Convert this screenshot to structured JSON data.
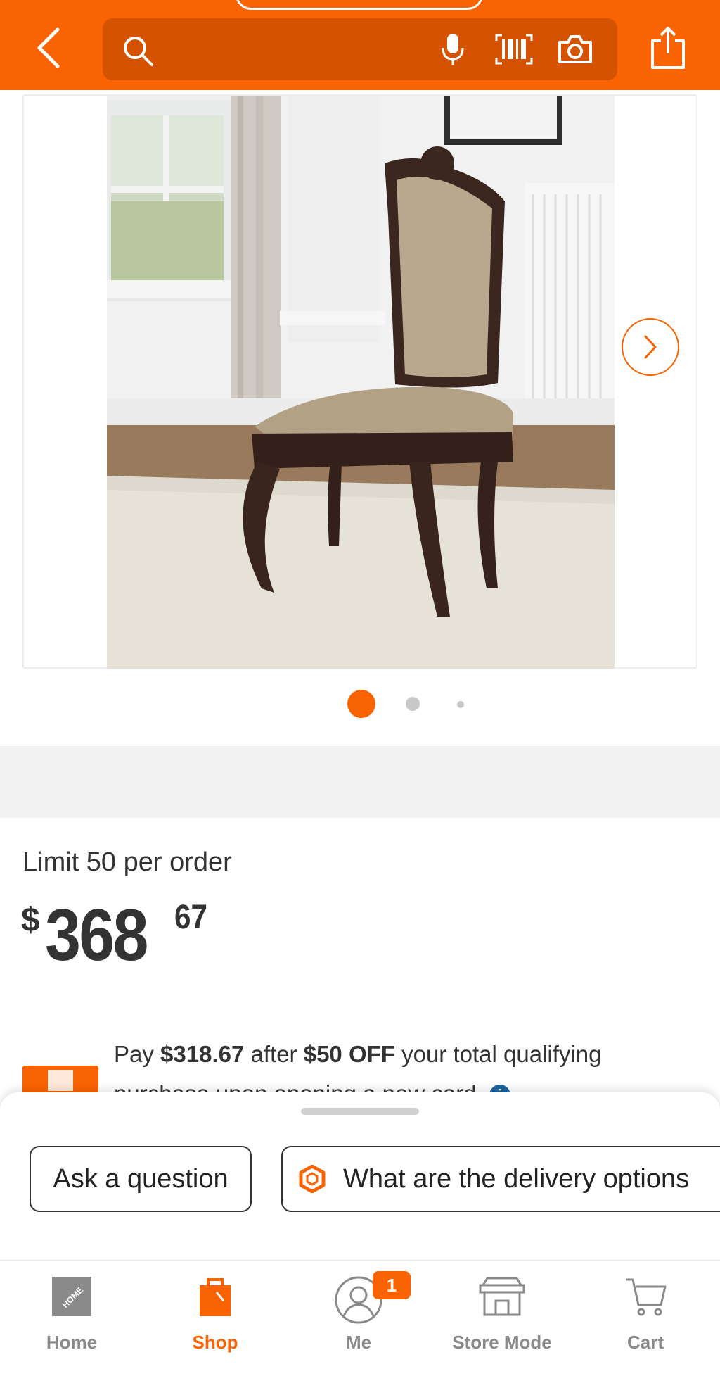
{
  "colors": {
    "brand_orange": "#f96302",
    "search_bg": "#d45200",
    "text": "#333333",
    "inactive_tab": "#8a8a8a",
    "info_blue": "#1a64a0"
  },
  "header": {
    "back_icon": "chevron-left-icon",
    "search_icon": "search-icon",
    "mic_icon": "microphone-icon",
    "barcode_icon": "barcode-scan-icon",
    "camera_icon": "camera-icon",
    "share_icon": "share-icon"
  },
  "gallery": {
    "image_alt": "Dining side chair with carved dark wood frame and patterned upholstery",
    "slide_count": 3,
    "active_slide": 1
  },
  "product": {
    "limit_text": "Limit 50 per order",
    "price_currency": "$",
    "price_dollars": "368",
    "price_cents": "67"
  },
  "offer": {
    "text_pay": "Pay ",
    "sale_price": "$318.67",
    "text_after": " after ",
    "discount": "$50 OFF",
    "text_rest": " your total qualifying purchase upon opening a new card.",
    "info_glyph": "i"
  },
  "sheet": {
    "ask_label": "Ask a question",
    "delivery_label": "What are the delivery options"
  },
  "tabs": [
    {
      "label": "Home",
      "icon": "home-depot-logo-icon",
      "active": false
    },
    {
      "label": "Shop",
      "icon": "shop-bag-icon",
      "active": true
    },
    {
      "label": "Me",
      "icon": "user-icon",
      "active": false,
      "badge": "1"
    },
    {
      "label": "Store Mode",
      "icon": "store-icon",
      "active": false
    },
    {
      "label": "Cart",
      "icon": "cart-icon",
      "active": false
    }
  ]
}
